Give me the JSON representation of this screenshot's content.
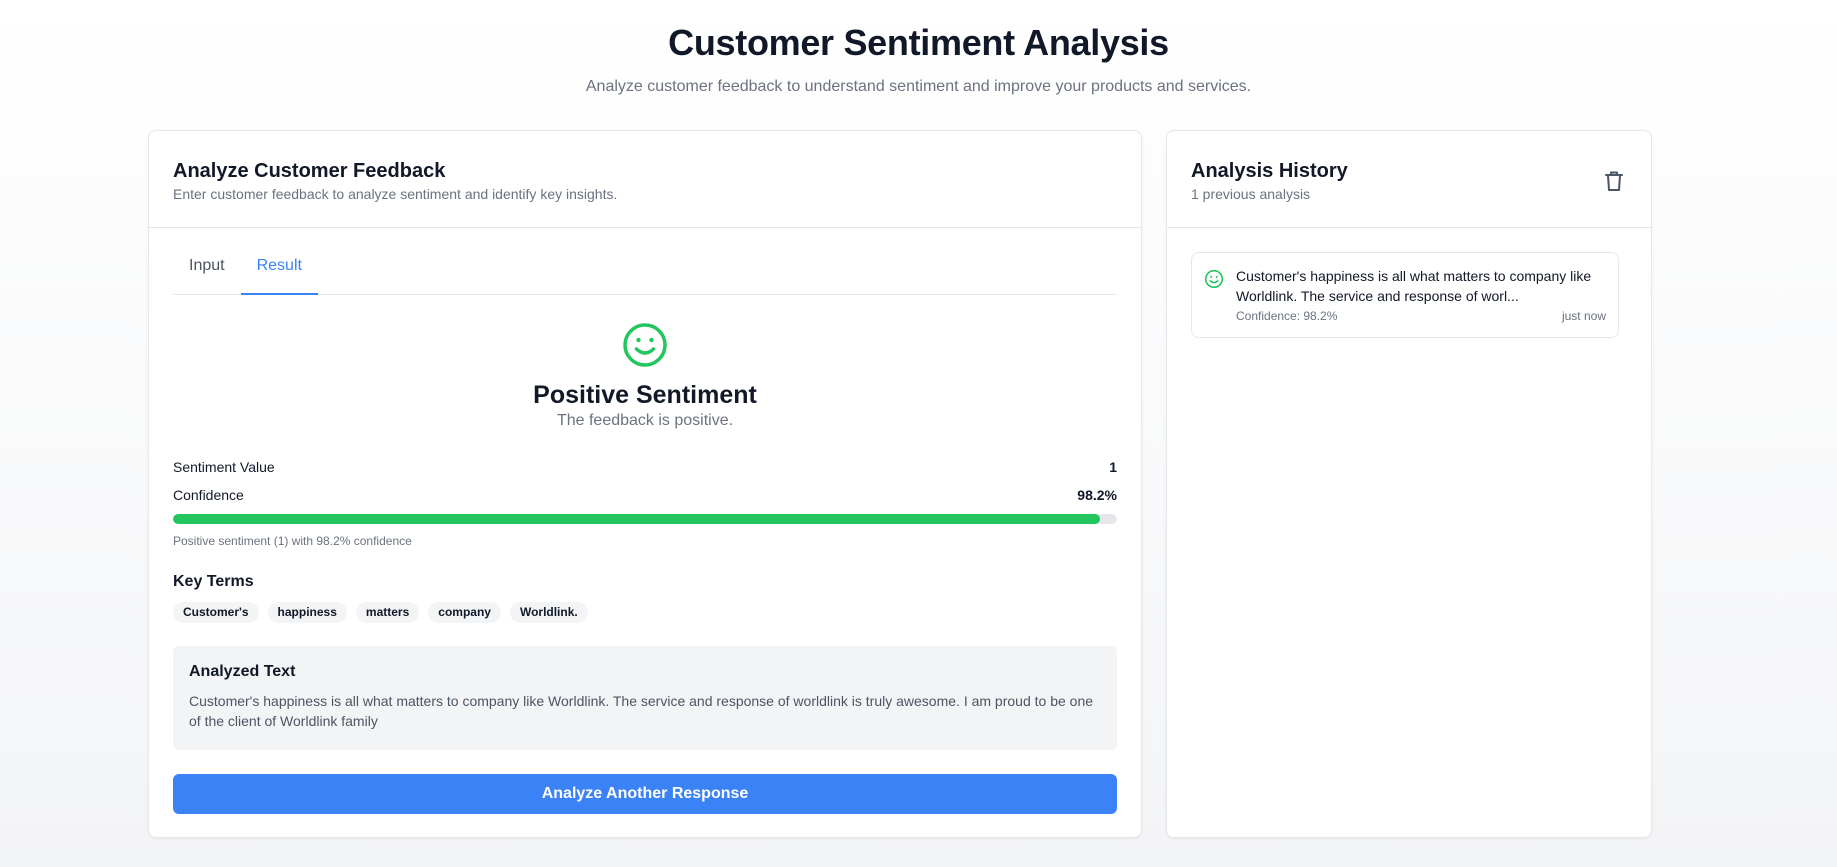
{
  "header": {
    "title": "Customer Sentiment Analysis",
    "subtitle": "Analyze customer feedback to understand sentiment and improve your products and services."
  },
  "analyze_card": {
    "title": "Analyze Customer Feedback",
    "description": "Enter customer feedback to analyze sentiment and identify key insights.",
    "tabs": [
      {
        "label": "Input",
        "active": false
      },
      {
        "label": "Result",
        "active": true
      }
    ],
    "result": {
      "icon": "smile-icon",
      "sentiment_title": "Positive Sentiment",
      "sentiment_desc": "The feedback is positive.",
      "sentiment_value_label": "Sentiment Value",
      "sentiment_value": "1",
      "confidence_label": "Confidence",
      "confidence_value": "98.2%",
      "confidence_fraction": 0.982,
      "confidence_note": "Positive sentiment (1) with 98.2% confidence",
      "key_terms_title": "Key Terms",
      "key_terms": [
        "Customer's",
        "happiness",
        "matters",
        "company",
        "Worldlink."
      ],
      "analyzed_title": "Analyzed Text",
      "analyzed_text": "Customer's happiness is all what matters to company like Worldlink. The service and response of worldlink is truly awesome. I am proud to be one of the client of Worldlink family",
      "button_label": "Analyze Another Response"
    }
  },
  "history_card": {
    "title": "Analysis History",
    "count_text": "1 previous analysis",
    "clear_icon": "trash-icon",
    "items": [
      {
        "icon": "smile-icon",
        "text": "Customer's happiness is all what matters to company like Worldlink. The service and response of worl...",
        "confidence": "Confidence: 98.2%",
        "time": "just now"
      }
    ]
  },
  "colors": {
    "accent": "#3b82f6",
    "positive": "#22c55e",
    "muted_text": "#6b7280",
    "border": "#e5e7eb"
  }
}
